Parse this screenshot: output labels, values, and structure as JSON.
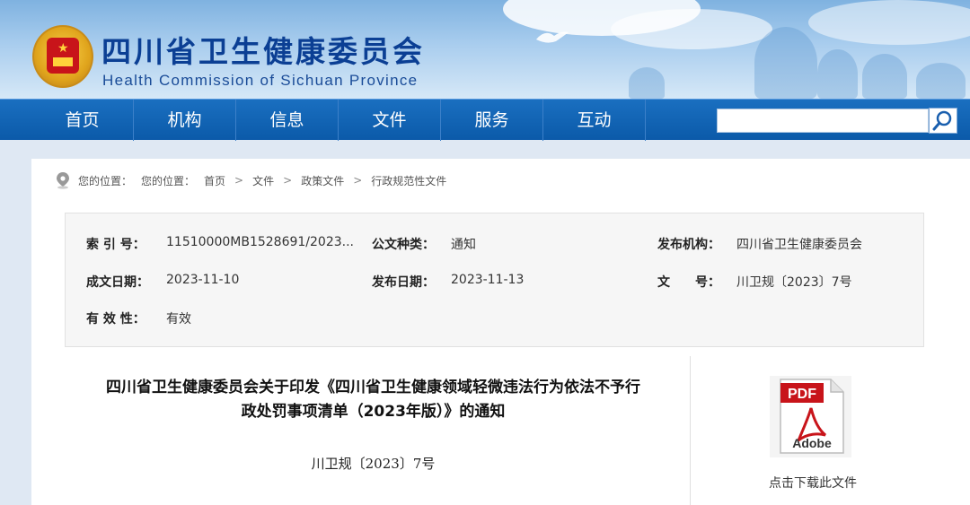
{
  "header": {
    "title": "四川省卫生健康委员会",
    "subtitle": "Health Commission of Sichuan Province"
  },
  "nav": {
    "items": [
      "首页",
      "机构",
      "信息",
      "文件",
      "服务",
      "互动"
    ],
    "search_value": ""
  },
  "breadcrumb": {
    "lead1": "您的位置：",
    "lead2": "您的位置：",
    "crumbs": [
      "首页",
      "文件",
      "政策文件",
      "行政规范性文件"
    ],
    "separator": ">"
  },
  "meta": {
    "index_label": "索 引 号：",
    "index_value": "11510000MB1528691/2023...",
    "doctype_label": "公文种类：",
    "doctype_value": "通知",
    "issuer_label": "发布机构：",
    "issuer_value": "四川省卫生健康委员会",
    "created_label": "成文日期：",
    "created_value": "2023-11-10",
    "published_label": "发布日期：",
    "published_value": "2023-11-13",
    "docno_label": "文　　号：",
    "docno_value": "川卫规〔2023〕7号",
    "validity_label": "有 效 性：",
    "validity_value": "有效"
  },
  "document": {
    "title_line1": "四川省卫生健康委员会关于印发《四川省卫生健康领域轻微违法行为依法不予行",
    "title_line2": "政处罚事项清单（2023年版）》的通知",
    "number": "川卫规〔2023〕7号"
  },
  "download": {
    "pdf_text": "PDF",
    "brand_text": "Adobe",
    "label": "点击下载此文件"
  },
  "colors": {
    "nav": "#0b5aa9",
    "title": "#0b3f94",
    "pdf_red": "#c8141a"
  }
}
